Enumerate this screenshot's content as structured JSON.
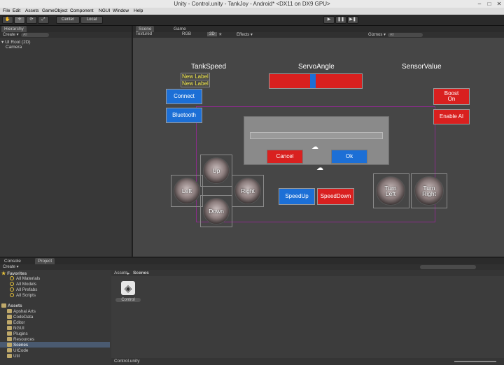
{
  "window": {
    "title": "Unity - Control.unity - TankJoy - Android* <DX11 on DX9 GPU>",
    "min": "–",
    "max": "□",
    "close": "✕"
  },
  "menu": [
    "File",
    "Edit",
    "Assets",
    "GameObject",
    "Component",
    "NGUI",
    "Window",
    "Help"
  ],
  "toolbar": {
    "center": "Center",
    "local": "Local",
    "play": "▶",
    "pause": "❚❚",
    "step": "▶❚"
  },
  "hierarchy": {
    "tab": "Hierarchy",
    "create": "Create ▾",
    "search_placeholder": "All",
    "items": [
      "▾ UI Root (2D)",
      "Camera"
    ]
  },
  "scene": {
    "tab_scene": "Scene",
    "tab_game": "Game",
    "shading": "Textured",
    "render": "RGB",
    "mode2d": "2D",
    "effects": "Effects ▾",
    "gizmos": "Gizmos ▾",
    "search_placeholder": "All"
  },
  "ui": {
    "tankspeed": "TankSpeed",
    "servoangle": "ServoAngle",
    "sensorvalue": "SensorValue",
    "new_label_1": "New Label",
    "new_label_2": "New Label",
    "connect": "Connect",
    "bluetooth": "Bluetooth",
    "boost_on": "Boost On",
    "enable_ai": "Enable AI",
    "cancel": "Cancel",
    "ok": "Ok",
    "up": "Up",
    "left": "Left",
    "right": "Right",
    "down": "Down",
    "speedup": "SpeedUp",
    "speeddown": "SpeedDown",
    "turn_left": "Turn Left",
    "turn_right": "Turn Right",
    "servo_value": 0.46
  },
  "bottom": {
    "tab_console": "Console",
    "tab_project": "Project",
    "create": "Create ▾",
    "favorites_header": "Favorites",
    "favorites": [
      "All Materials",
      "All Models",
      "All Prefabs",
      "All Scripts"
    ],
    "assets_header": "Assets",
    "folders": [
      "Apshai Arts",
      "CodeData",
      "Editor",
      "NGUI",
      "Plugins",
      "Resources",
      "Scenes",
      "UICode",
      "Util"
    ],
    "breadcrumb_root": "Assets",
    "breadcrumb_sep": "▸",
    "breadcrumb_leaf": "Scenes",
    "asset_name": "Control",
    "status_file": "Control.unity"
  }
}
